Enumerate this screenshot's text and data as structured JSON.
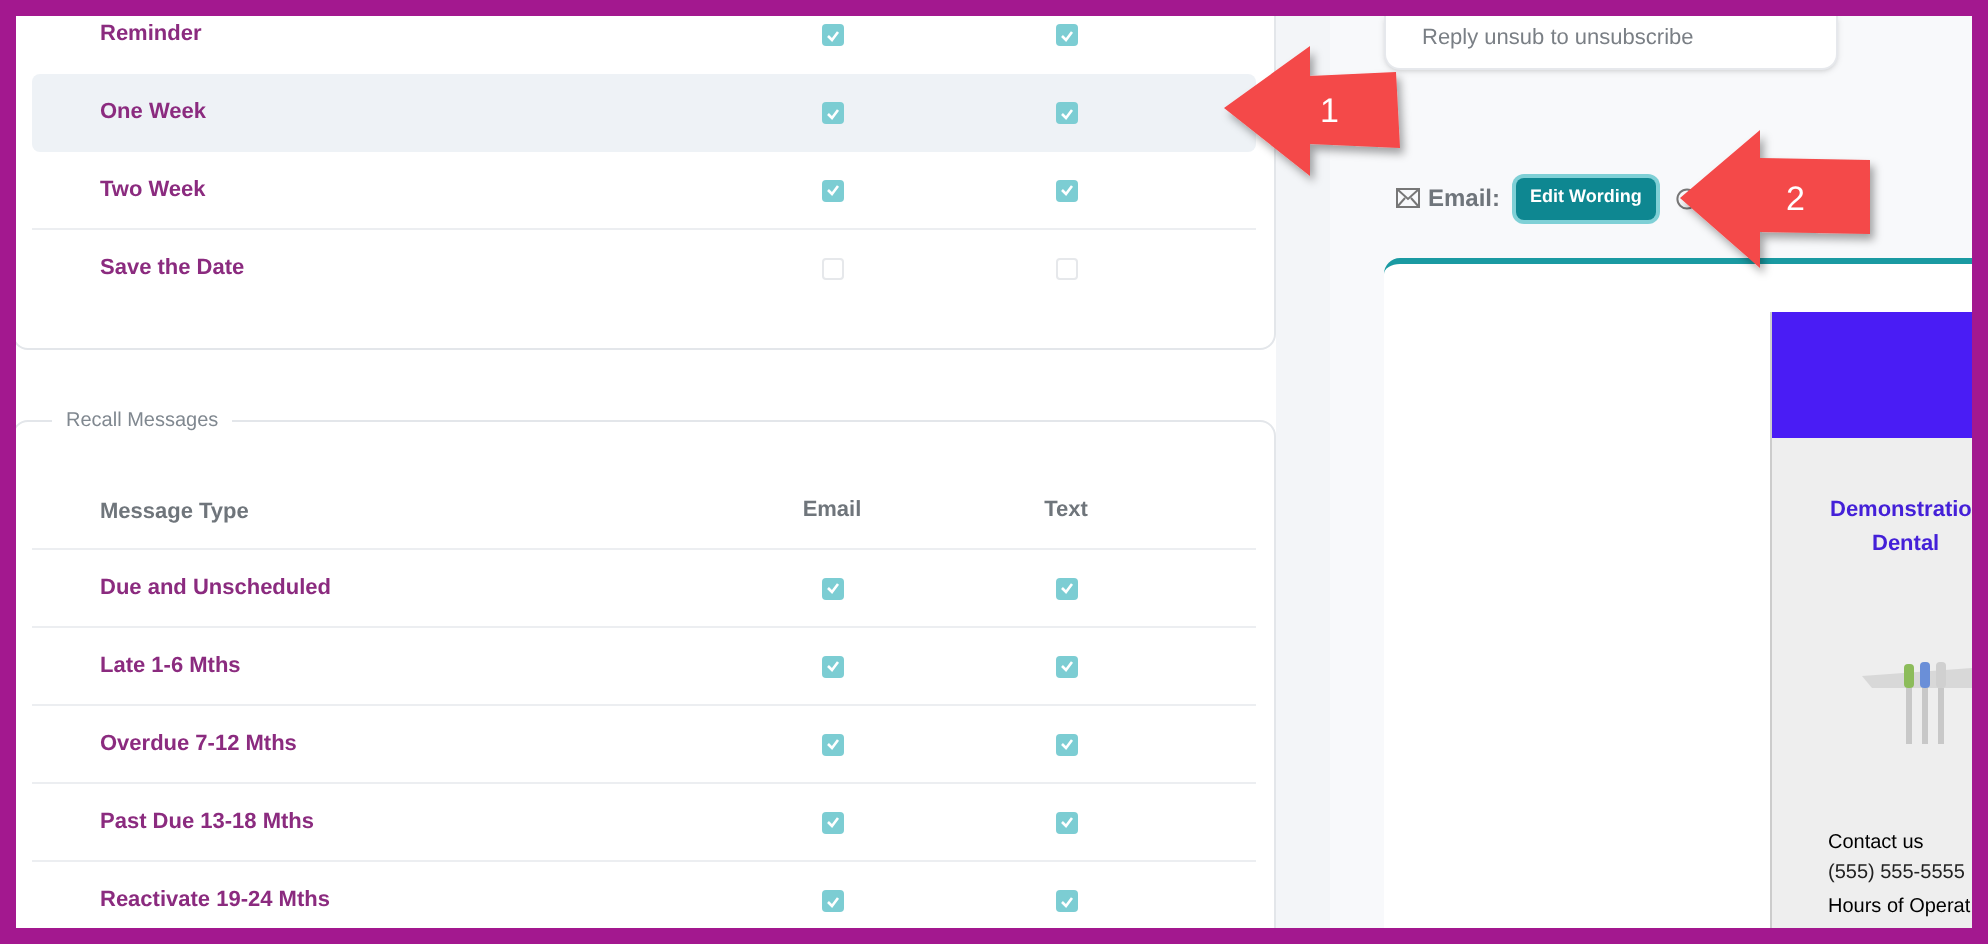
{
  "top_card": {
    "text": "Reply unsub to unsubscribe"
  },
  "appointment_rows": [
    {
      "label": "Reminder",
      "selected": false,
      "email": true,
      "text": true
    },
    {
      "label": "One Week",
      "selected": true,
      "email": true,
      "text": true
    },
    {
      "label": "Two Week",
      "selected": false,
      "email": true,
      "text": true
    },
    {
      "label": "Save the Date",
      "selected": false,
      "email": false,
      "text": false
    }
  ],
  "recall": {
    "legend": "Recall Messages",
    "columns": [
      "Message Type",
      "Email",
      "Text"
    ],
    "rows": [
      {
        "label": "Due and Unscheduled",
        "email": true,
        "text": true
      },
      {
        "label": "Late 1-6 Mths",
        "email": true,
        "text": true
      },
      {
        "label": "Overdue 7-12 Mths",
        "email": true,
        "text": true
      },
      {
        "label": "Past Due 13-18 Mths",
        "email": true,
        "text": true
      },
      {
        "label": "Reactivate 19-24 Mths",
        "email": true,
        "text": true
      }
    ]
  },
  "email_section": {
    "label": "Email:",
    "button": "Edit Wording"
  },
  "preview": {
    "title_lines": [
      "Demonstratio",
      "Dental"
    ],
    "contact": "Contact us",
    "phone": "(555) 555-5555",
    "hours": "Hours of Operat"
  },
  "annotations": [
    {
      "label": "1"
    },
    {
      "label": "2"
    }
  ]
}
